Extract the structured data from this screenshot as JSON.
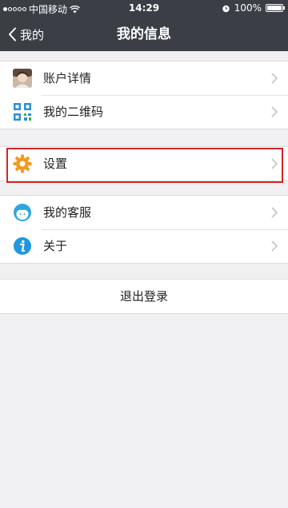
{
  "status_bar": {
    "carrier": "中国移动",
    "time": "14:29",
    "battery": "100%"
  },
  "nav": {
    "back_label": "我的",
    "title": "我的信息"
  },
  "group1": {
    "items": [
      {
        "label": "账户详情",
        "icon": "avatar-icon"
      },
      {
        "label": "我的二维码",
        "icon": "qr-code-icon"
      }
    ]
  },
  "group2": {
    "items": [
      {
        "label": "设置",
        "icon": "gear-icon"
      }
    ]
  },
  "group3": {
    "items": [
      {
        "label": "我的客服",
        "icon": "customer-service-icon"
      },
      {
        "label": "关于",
        "icon": "info-icon"
      }
    ]
  },
  "logout": {
    "label": "退出登录"
  },
  "colors": {
    "nav_bg": "#3b3f45",
    "page_bg": "#f0f0f2",
    "highlight": "#d42427",
    "gear": "#f29a1f",
    "service": "#2fa7dc",
    "info": "#1f97e0"
  }
}
